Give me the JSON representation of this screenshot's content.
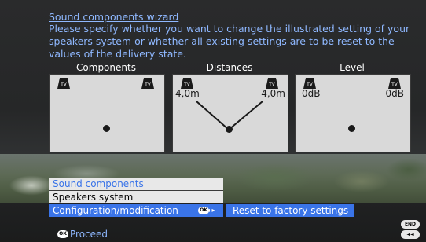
{
  "wizard": {
    "title": "Sound components wizard ",
    "description": "Please specify whether you want to change the illustrated setting of your speakers system or whether all existing settings are to be reset to the values of the delivery state."
  },
  "panels": {
    "components": {
      "label": "Components"
    },
    "distances": {
      "label": "Distances",
      "left_value": "4,0m",
      "right_value": "4,0m"
    },
    "level": {
      "label": "Level",
      "left_value": "0dB",
      "right_value": "0dB"
    },
    "tv_label": "TV"
  },
  "menu": {
    "items": [
      {
        "label": "Sound components"
      },
      {
        "label": "Speakers system"
      },
      {
        "label": "Configuration/modification"
      }
    ],
    "action_button": "Reset to factory settings"
  },
  "keys": {
    "ok": "OK",
    "end": "END",
    "back": "◄◄",
    "proceed_label": "Proceed"
  },
  "colors": {
    "accent": "#3a74e8",
    "title_text": "#8fb8ff",
    "panel_bg": "#d9d9d9"
  }
}
